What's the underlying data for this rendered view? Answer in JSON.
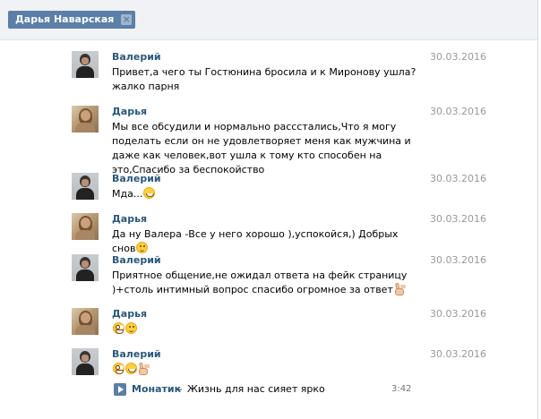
{
  "header": {
    "tag_label": "Дарья Наварская",
    "tag_close_icon": "close-icon"
  },
  "messages": [
    {
      "author": "Валерий",
      "date": "30.03.2016",
      "avatar": "valeriy-avatar",
      "text": "Привет,а чего ты Гостюнина бросила и к Миронову ушла?жалко парня",
      "emoji": []
    },
    {
      "author": "Дарья",
      "date": "30.03.2016",
      "avatar": "darya-avatar",
      "text": "Мы все обсудили и нормально расcстались,Что я могу поделать если он не удовлетворяет меня как мужчина и даже как человек,вот ушла к тому кто способен на это,Спасибо за беспокойство",
      "emoji": []
    },
    {
      "author": "Валерий",
      "date": "30.03.2016",
      "avatar": "valeriy-avatar",
      "text": "Мда...",
      "emoji": [
        "smile"
      ]
    },
    {
      "author": "Дарья",
      "date": "30.03.2016",
      "avatar": "darya-avatar",
      "text": "Да ну Валера -Все у него хорошо ),успокойся,) Добрых снов",
      "emoji": [
        "wink"
      ]
    },
    {
      "author": "Валерий",
      "date": "30.03.2016",
      "avatar": "valeriy-avatar",
      "text": "Приятное общение,не ожидал ответа на фейк страницу )+столь интимный вопрос спасибо огромное за ответ",
      "emoji": [
        "peace"
      ]
    },
    {
      "author": "Дарья",
      "date": "30.03.2016",
      "avatar": "darya-avatar",
      "text": "",
      "emoji": [
        "grin",
        "wink"
      ]
    },
    {
      "author": "Валерий",
      "date": "30.03.2016",
      "avatar": "valeriy-avatar",
      "text": "",
      "emoji": [
        "grin",
        "smile",
        "peace"
      ]
    }
  ],
  "audio": {
    "artist": "Монатик",
    "separator": "–",
    "title": "Жизнь для нас сияет ярко",
    "duration": "3:42",
    "play_icon": "play-icon"
  }
}
